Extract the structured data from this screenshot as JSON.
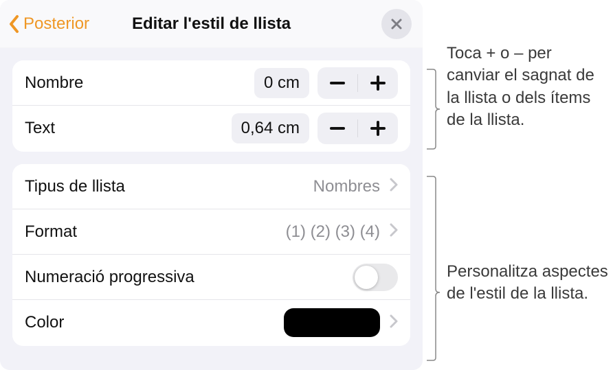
{
  "header": {
    "back_label": "Posterior",
    "title": "Editar l'estil de llista"
  },
  "group1": {
    "rows": [
      {
        "label": "Nombre",
        "value": "0 cm"
      },
      {
        "label": "Text",
        "value": "0,64 cm"
      }
    ]
  },
  "group2": {
    "list_type": {
      "label": "Tipus de llista",
      "value": "Nombres"
    },
    "format": {
      "label": "Format",
      "value": "(1) (2) (3) (4)"
    },
    "progressive": {
      "label": "Numeració progressiva",
      "on": false
    },
    "color": {
      "label": "Color",
      "hex": "#000000"
    }
  },
  "callouts": {
    "c1": "Toca + o – per canviar el sagnat de la llista o dels ítems de la llista.",
    "c2": "Personalitza aspectes de l'estil de la llista."
  }
}
